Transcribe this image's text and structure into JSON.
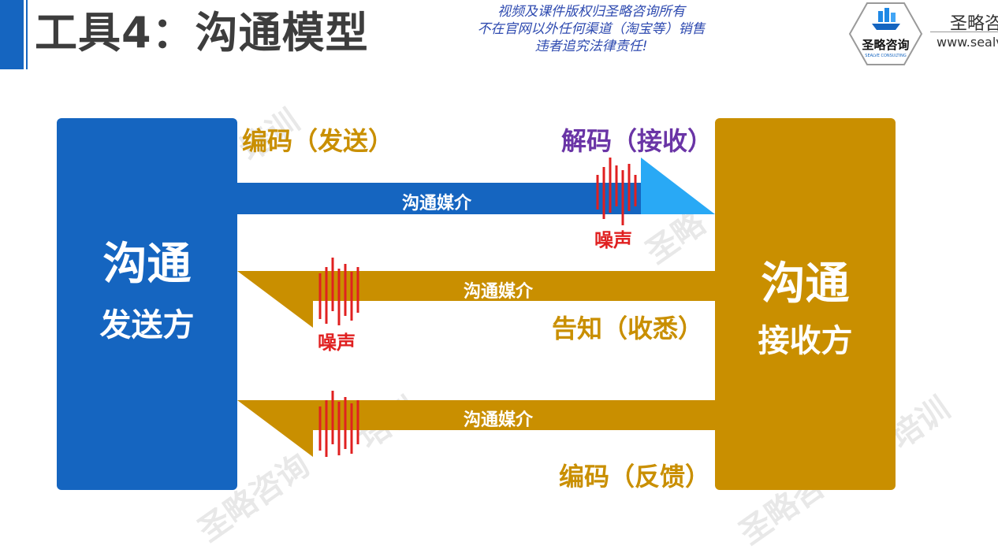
{
  "header": {
    "title": "工具4：沟通模型",
    "copyright_lines": [
      "视频及课件版权归圣略咨询所有",
      "不在官网以外任何渠道（淘宝等）销售",
      "违者追究法律责任!"
    ],
    "brand_logo_text": "圣略咨询",
    "brand_logo_subtext": "SEALVE CONSULTING",
    "brand_name": "圣略咨",
    "brand_url": "www.sealv"
  },
  "watermarks": [
    "培训",
    "圣略",
    "培训",
    "圣略咨询",
    "培训",
    "圣略咨"
  ],
  "sender": {
    "line1": "沟通",
    "line2": "发送方"
  },
  "receiver": {
    "line1": "沟通",
    "line2": "接收方"
  },
  "channels": [
    {
      "medium": "沟通媒介",
      "noise": "噪声"
    },
    {
      "medium": "沟通媒介",
      "noise": "噪声"
    },
    {
      "medium": "沟通媒介"
    }
  ],
  "labels": {
    "encode_send": "编码（发送）",
    "decode_receive": "解码（接收）",
    "acknowledge": "告知（收悉）",
    "encode_feedback": "编码（反馈）"
  },
  "colors": {
    "sender_blue": "#1565c0",
    "receiver_gold": "#c98f00",
    "arrow_light_blue": "#29a9f5",
    "noise_red": "#e02020",
    "label_gold": "#c98f00",
    "label_purple": "#6a35a6",
    "copyright_blue": "#2f4bb0"
  }
}
